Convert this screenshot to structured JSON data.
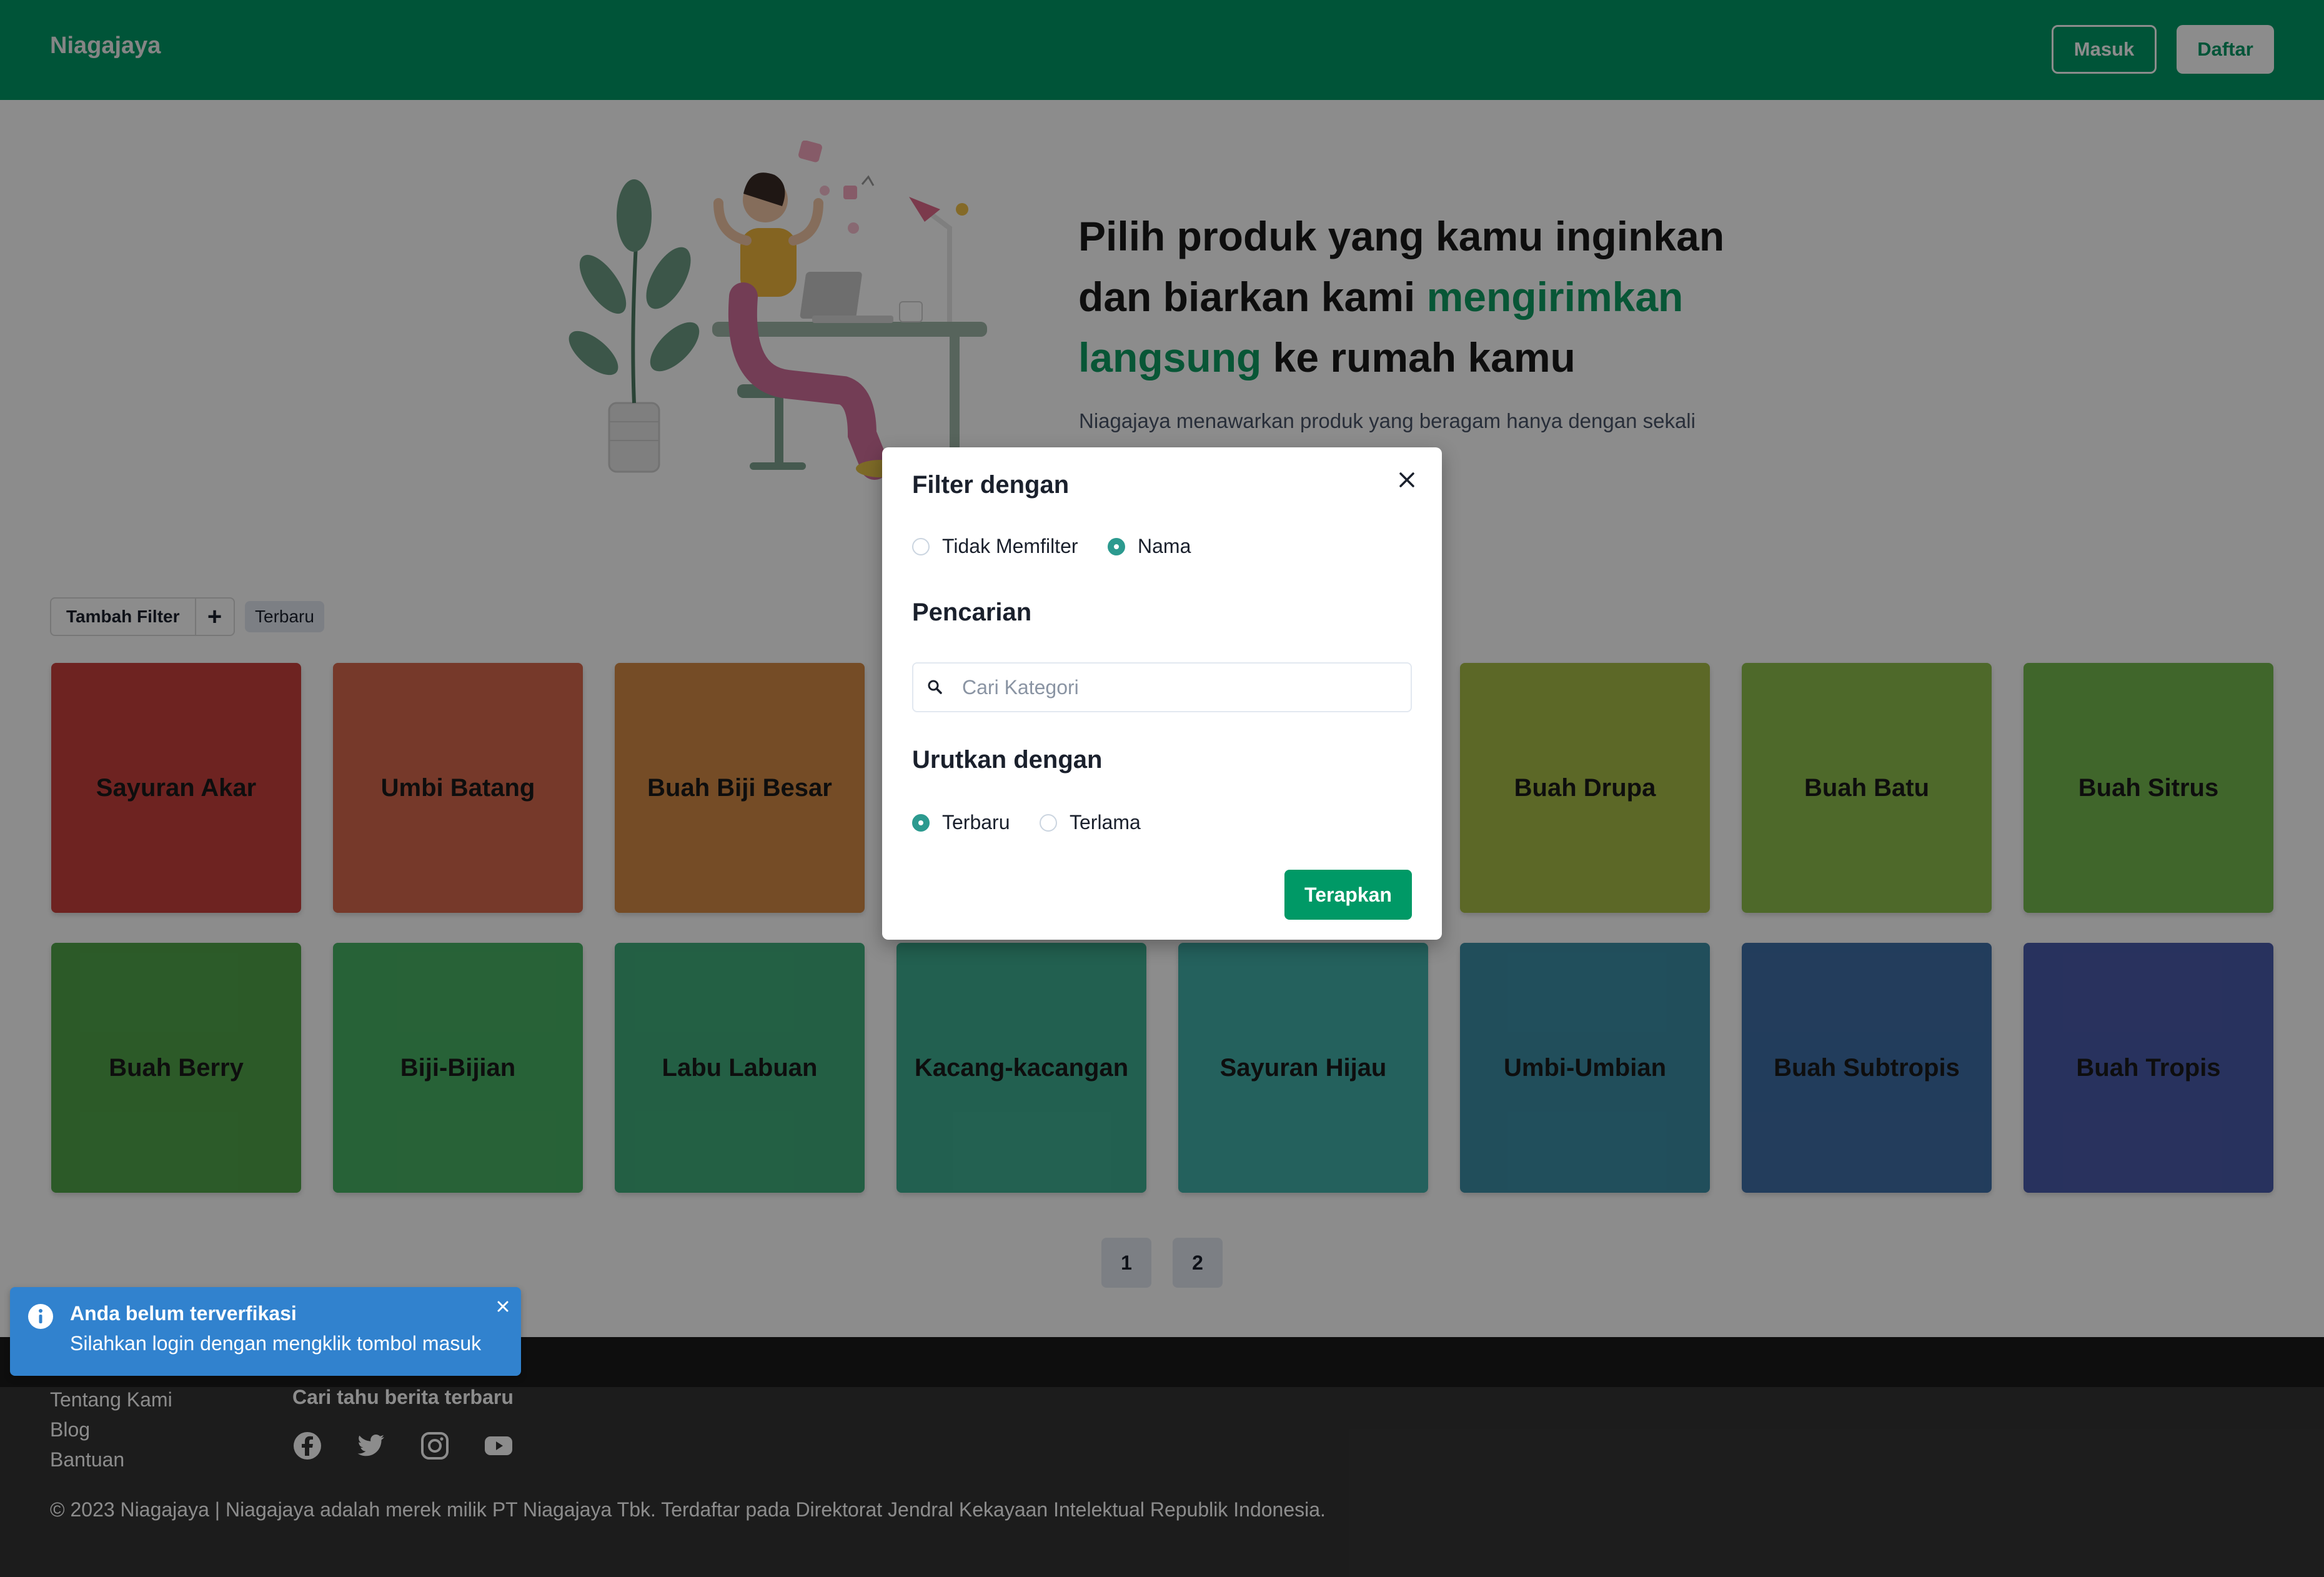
{
  "header": {
    "brand": "Niagajaya",
    "login_label": "Masuk",
    "register_label": "Daftar"
  },
  "hero": {
    "title_line1": "Pilih produk yang kamu inginkan",
    "title_line2_a": "dan biarkan kami ",
    "title_line2_b": "mengirimkan",
    "title_line3_a": "langsung",
    "title_line3_b": " ke rumah kamu",
    "subtitle": "Niagajaya menawarkan produk yang beragam hanya dengan sekali"
  },
  "filter_bar": {
    "add_filter_label": "Tambah Filter",
    "add_icon": "+",
    "active_tag": "Terbaru"
  },
  "categories": [
    {
      "label": "Sayuran Akar",
      "color": "#c9403d"
    },
    {
      "label": "Umbi Batang",
      "color": "#d8694e"
    },
    {
      "label": "Buah Biji Besar",
      "color": "#d68b46"
    },
    {
      "label": "",
      "color": "#d8a541"
    },
    {
      "label": "",
      "color": "#c9b94a"
    },
    {
      "label": "Buah Drupa",
      "color": "#a8bd48"
    },
    {
      "label": "Buah Batu",
      "color": "#8fbf4d"
    },
    {
      "label": "Buah Sitrus",
      "color": "#76bb4f"
    },
    {
      "label": "Buah Berry",
      "color": "#51a54a"
    },
    {
      "label": "Biji-Bijian",
      "color": "#48b264"
    },
    {
      "label": "Labu Labuan",
      "color": "#40ae7c"
    },
    {
      "label": "Kacang-kacangan",
      "color": "#3fb093"
    },
    {
      "label": "Sayuran Hijau",
      "color": "#42b1aa"
    },
    {
      "label": "Umbi-Umbian",
      "color": "#3d8fa7"
    },
    {
      "label": "Buah Subtropis",
      "color": "#3f6fa8"
    },
    {
      "label": "Buah Tropis",
      "color": "#4a5bab"
    }
  ],
  "pagination": [
    "1",
    "2"
  ],
  "footer": {
    "links": [
      "Tentang Kami",
      "Blog",
      "Bantuan"
    ],
    "news_title": "Cari tahu berita terbaru",
    "social_icons": [
      "facebook-icon",
      "twitter-icon",
      "instagram-icon",
      "youtube-icon"
    ],
    "copyright": "© 2023 Niagajaya | Niagajaya adalah merek milik PT Niagajaya Tbk. Terdaftar pada Direktorat Jendral Kekayaan Intelektual Republik Indonesia."
  },
  "modal": {
    "title": "Filter dengan",
    "filter_options": [
      "Tidak Memfilter",
      "Nama"
    ],
    "filter_selected": "Nama",
    "search_heading": "Pencarian",
    "search_placeholder": "Cari Kategori",
    "search_value": "",
    "sort_heading": "Urutkan dengan",
    "sort_options": [
      "Terbaru",
      "Terlama"
    ],
    "sort_selected": "Terbaru",
    "apply_label": "Terapkan"
  },
  "toast": {
    "title": "Anda belum terverfikasi",
    "message": "Silahkan login dengan mengklik tombol masuk"
  },
  "colors": {
    "primary": "#009966",
    "accent_radio": "#2c9a8f",
    "toast_blue": "#3182ce"
  }
}
